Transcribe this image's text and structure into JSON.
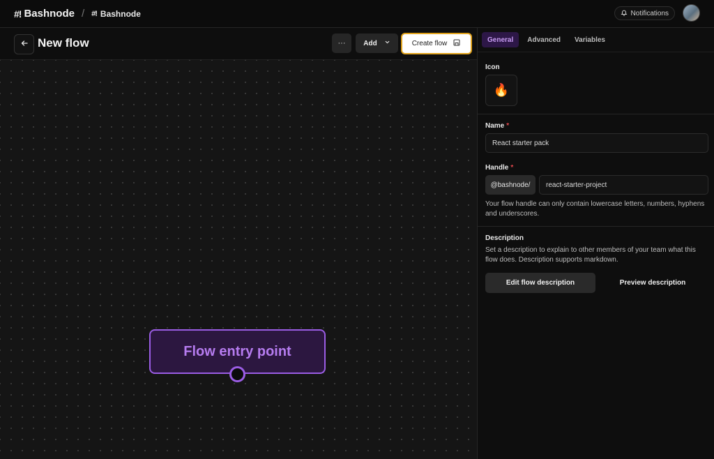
{
  "topbar": {
    "brand_mark": "#!",
    "brand_name": "Bashnode",
    "separator": "/",
    "workspace_mark": "#!",
    "workspace_name": "Bashnode",
    "notifications_label": "Notifications"
  },
  "flow_header": {
    "title": "New flow",
    "more_label": "···",
    "add_label": "Add",
    "create_label": "Create flow"
  },
  "canvas": {
    "entry_node_label": "Flow entry point"
  },
  "panel": {
    "tabs": [
      {
        "label": "General",
        "active": true
      },
      {
        "label": "Advanced",
        "active": false
      },
      {
        "label": "Variables",
        "active": false
      }
    ],
    "icon_label": "Icon",
    "icon_value": "🔥",
    "name_label": "Name",
    "name_required": "*",
    "name_value": "React starter pack",
    "handle_label": "Handle",
    "handle_required": "*",
    "handle_prefix": "@bashnode/",
    "handle_value": "react-starter-project",
    "handle_help": "Your flow handle can only contain lowercase letters, numbers, hyphens and underscores.",
    "description_label": "Description",
    "description_help": "Set a description to explain to other members of your team what this flow does. Description supports markdown.",
    "edit_description_label": "Edit flow description",
    "preview_description_label": "Preview description"
  },
  "colors": {
    "accent_purple": "#9b5de5",
    "highlight_orange": "#e0a21c",
    "required_red": "#e5484d"
  }
}
